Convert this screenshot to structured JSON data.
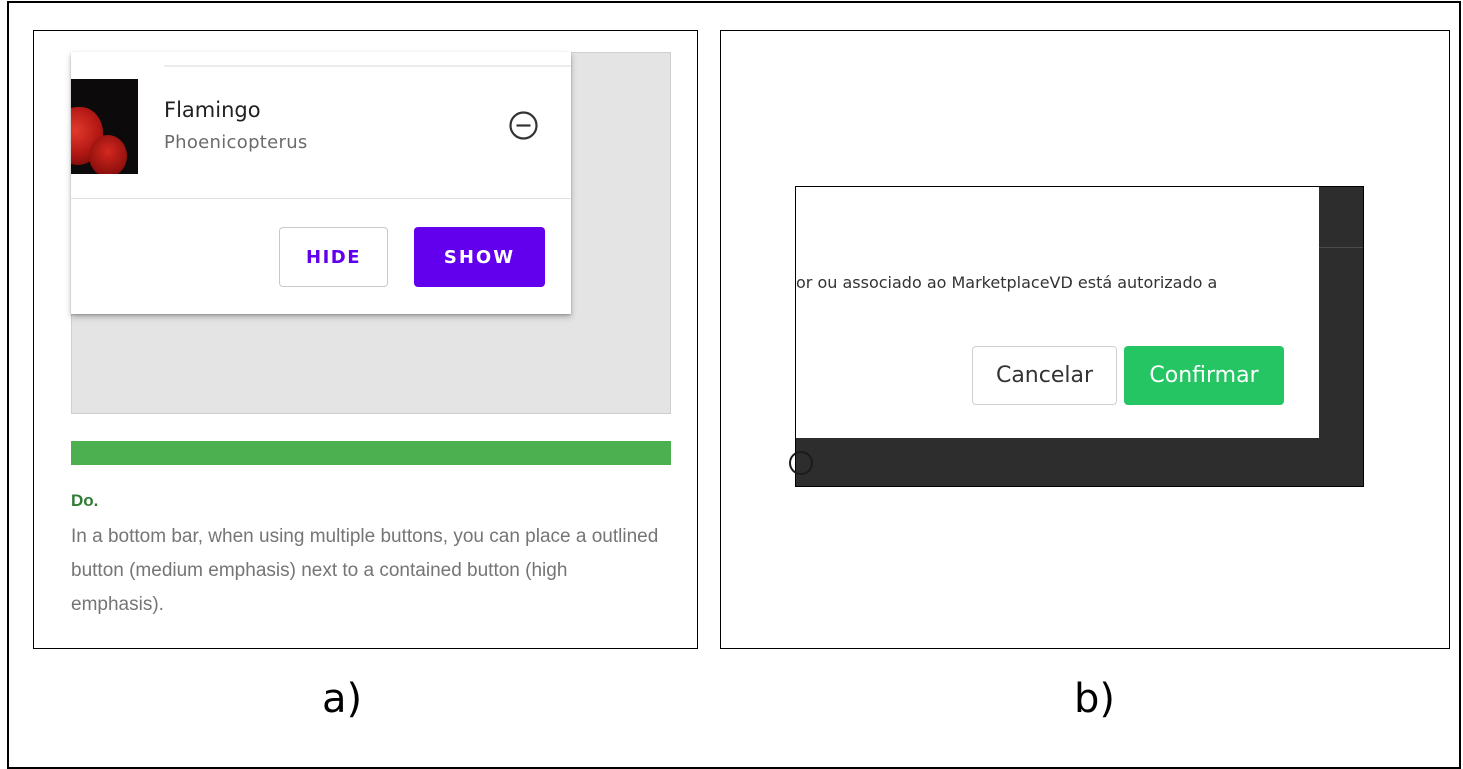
{
  "panel_a": {
    "list_item": {
      "title": "Flamingo",
      "subtitle": "Phoenicopterus",
      "remove_icon": "minus-circle-icon"
    },
    "buttons": {
      "hide_label": "HIDE",
      "show_label": "SHOW"
    },
    "guideline": {
      "label": "Do.",
      "text": "In a bottom bar, when using multiple buttons, you can place a outlined button (medium emphasis) next to a contained button (high emphasis)."
    },
    "colors": {
      "primary": "#6200ee",
      "do_green": "#4caf50",
      "do_label": "#2e7d32"
    },
    "caption": "a)"
  },
  "panel_b": {
    "modal": {
      "text": "or ou associado ao MarketplaceVD está autorizado a",
      "cancel_label": "Cancelar",
      "confirm_label": "Confirmar"
    },
    "colors": {
      "confirm": "#25c564",
      "backdrop": "#2d2d2d"
    },
    "caption": "b)"
  }
}
